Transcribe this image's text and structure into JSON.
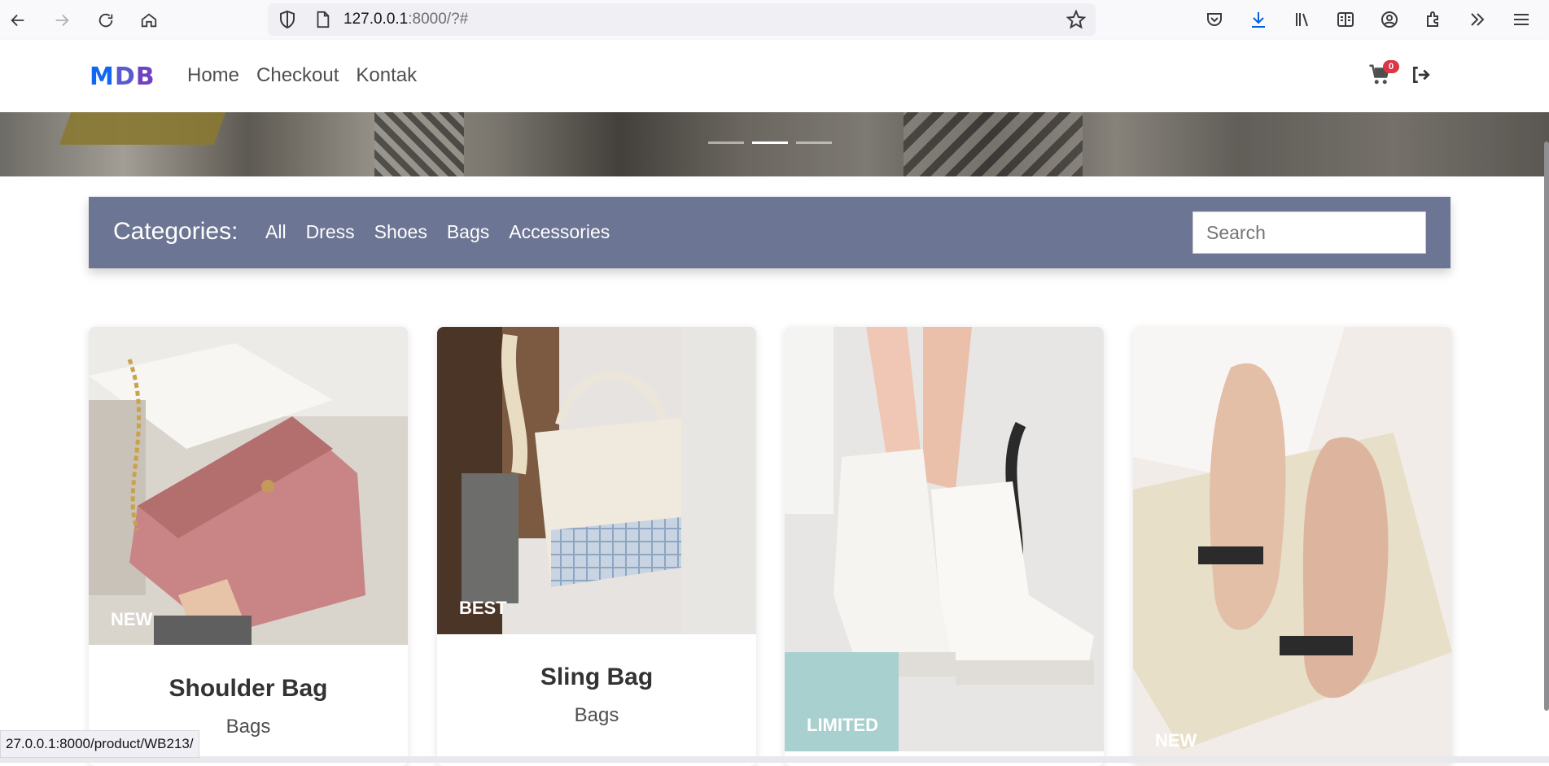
{
  "browser": {
    "url_host": "127.0.0.1",
    "url_rest": ":8000/?#",
    "status_url": "27.0.0.1:8000/product/WB213/"
  },
  "navbar": {
    "logo": [
      "M",
      "D",
      "B"
    ],
    "links": [
      "Home",
      "Checkout",
      "Kontak"
    ],
    "cart_count": "0"
  },
  "categories": {
    "title": "Categories:",
    "links": [
      "All",
      "Dress",
      "Shoes",
      "Bags",
      "Accessories"
    ],
    "search_placeholder": "Search"
  },
  "carousel": {
    "slides": 3,
    "active_index": 1
  },
  "products": [
    {
      "tag": "NEW",
      "title": "Shoulder Bag",
      "category": "Bags",
      "image": "pink-shoulder-bag"
    },
    {
      "tag": "BEST",
      "title": "Sling Bag",
      "category": "Bags",
      "image": "cream-sling-bag"
    },
    {
      "tag": "LIMITED",
      "title": "",
      "category": "",
      "image": "white-lace-boots"
    },
    {
      "tag": "NEW",
      "title": "",
      "category": "",
      "image": "beige-flat-shoes"
    }
  ],
  "colors": {
    "category_bar": "#6c7593",
    "cart_badge": "#dc3545",
    "logo_blue": "#1266f1",
    "logo_purple": "#6f42c1"
  }
}
